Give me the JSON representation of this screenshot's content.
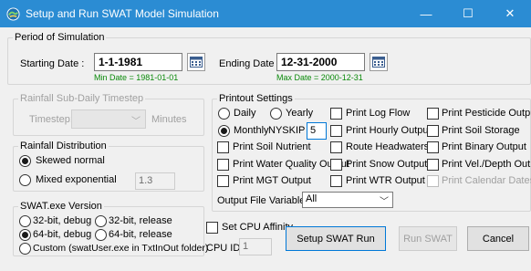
{
  "window": {
    "title": "Setup and Run SWAT Model Simulation",
    "minimize_glyph": "—",
    "maximize_glyph": "☐",
    "close_glyph": "✕",
    "titlebar_color": "#2b8cd3"
  },
  "period": {
    "legend": "Period of Simulation",
    "start_label": "Starting Date :",
    "start_value": "1-1-1981",
    "start_hint": "Min Date = 1981-01-01",
    "end_label": "Ending Date :",
    "end_value": "12-31-2000",
    "end_hint": "Max Date = 2000-12-31",
    "hint_color": "#0a8a0a"
  },
  "rainfall_timestep": {
    "legend": "Rainfall Sub-Daily Timestep",
    "timestep_label": "Timestep:",
    "units_label": "Minutes"
  },
  "rainfall_distribution": {
    "legend": "Rainfall Distribution",
    "options": [
      "Skewed normal",
      "Mixed exponential"
    ],
    "selected": "Skewed normal",
    "exponent_value": "1.3"
  },
  "swat_version": {
    "legend": "SWAT.exe Version",
    "options": [
      "32-bit, debug",
      "32-bit, release",
      "64-bit, debug",
      "64-bit, release",
      "Custom (swatUser.exe in TxtInOut folder)"
    ],
    "selected": "64-bit, debug"
  },
  "printout": {
    "legend": "Printout Settings",
    "frequency_options": [
      "Daily",
      "Yearly",
      "Monthly"
    ],
    "selected_frequency": "Monthly",
    "nyskip_label": "NYSKIP :",
    "nyskip_value": "5",
    "checkboxes": {
      "print_soil_nutrient": "Print Soil Nutrient",
      "print_water_quality": "Print Water Quality Output",
      "print_mgt": "Print MGT Output",
      "print_log_flow": "Print Log Flow",
      "print_hourly": "Print Hourly Output",
      "route_headwaters": "Route Headwaters",
      "print_snow": "Print Snow Output",
      "print_wtr": "Print WTR Output",
      "print_pesticide": "Print Pesticide Output",
      "print_soil_storage": "Print Soil Storage",
      "print_binary": "Print Binary Output",
      "print_vel_depth": "Print Vel./Depth Output",
      "print_calendar_dates": "Print Calendar Dates"
    },
    "output_vars_label": "Output File Variables:",
    "output_vars_value": "All"
  },
  "cpu": {
    "affinity_label": "Set CPU Affinity",
    "cpu_id_label": "CPU ID:",
    "cpu_id_value": "1"
  },
  "buttons": {
    "setup": "Setup SWAT Run",
    "run": "Run SWAT",
    "cancel": "Cancel"
  }
}
